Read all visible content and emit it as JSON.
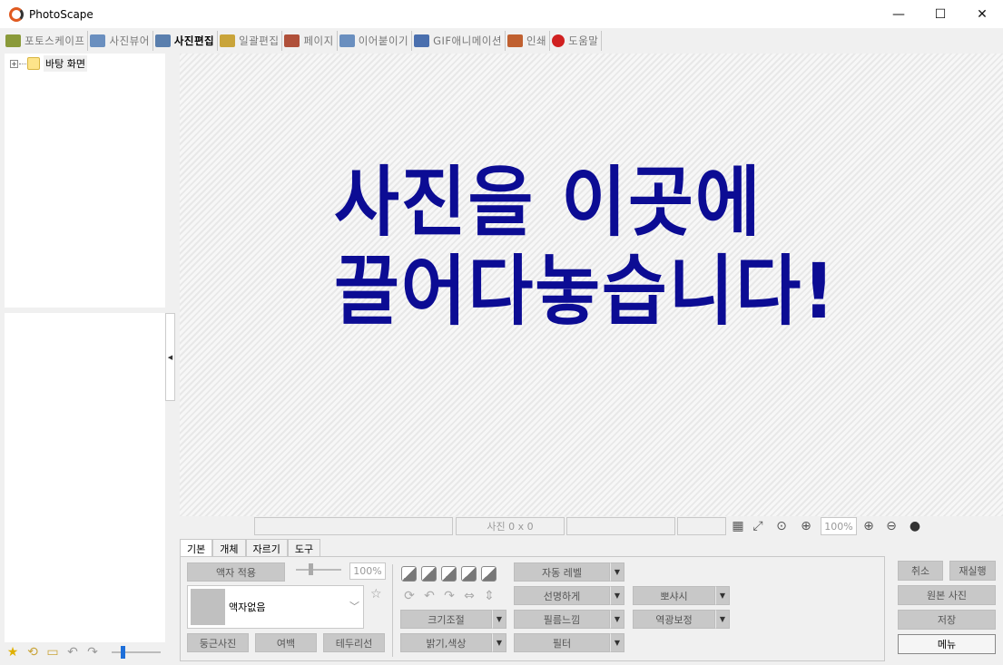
{
  "window": {
    "title": "PhotoScape",
    "minimize": "—",
    "maximize": "☐",
    "close": "✕"
  },
  "tabs": [
    {
      "label": "포토스케이프",
      "color": "#8a9a3a"
    },
    {
      "label": "사진뷰어",
      "color": "#6a8fbf"
    },
    {
      "label": "사진편집",
      "color": "#5a7fae",
      "active": true
    },
    {
      "label": "일괄편집",
      "color": "#c9a43a"
    },
    {
      "label": "페이지",
      "color": "#b0503a"
    },
    {
      "label": "이어붙이기",
      "color": "#6a8fbf"
    },
    {
      "label": "GIF애니메이션",
      "color": "#4a6fae"
    },
    {
      "label": "인쇄",
      "color": "#c06030"
    },
    {
      "label": "도움말",
      "color": "#d02020"
    }
  ],
  "tree": {
    "expander": "+",
    "root_label": "바탕 화면"
  },
  "splitter_arrow": "◀",
  "canvas": {
    "line1": "사진을 이곳에",
    "line2": "끌어다놓습니다!"
  },
  "status": {
    "size_text": "사진 0 x 0",
    "zoom": "100%"
  },
  "panel_tabs": [
    "기본",
    "개체",
    "자르기",
    "도구"
  ],
  "basic": {
    "frame_apply": "액자 적용",
    "frame_percent": "100%",
    "frame_none": "액자없음",
    "rounded": "둥근사진",
    "margin": "여백",
    "border": "테두리선",
    "resize": "크기조절",
    "brightness": "밝기,색상",
    "auto_level": "자동 레벨",
    "sharpen": "선명하게",
    "film": "필름느낌",
    "filter": "필터",
    "bloom": "뽀샤시",
    "backlight": "역광보정"
  },
  "actions": {
    "undo": "취소",
    "redo": "재실행",
    "original": "원본 사진",
    "save": "저장",
    "menu": "메뉴"
  }
}
